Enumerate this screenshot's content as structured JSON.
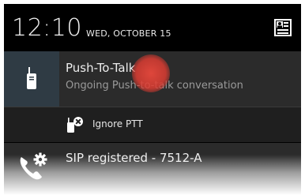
{
  "status_bar": {
    "time": "12:10",
    "date": "WED, OCTOBER 15"
  },
  "notification": {
    "title": "Push-To-Talk",
    "subtitle": "Ongoing Push-to-talk conversation",
    "icon": "walkie-talkie-icon",
    "action": {
      "label": "Ignore PTT",
      "icon": "ignore-ptt-icon"
    }
  },
  "sip_notification": {
    "title": "SIP registered - 7512-A",
    "icon": "phone-settings-icon"
  },
  "colors": {
    "shade_background": "#000000",
    "notification_background": "#2b2b2b",
    "icon_area_background": "#2f3b44",
    "touch_indicator": "#e8483c"
  }
}
